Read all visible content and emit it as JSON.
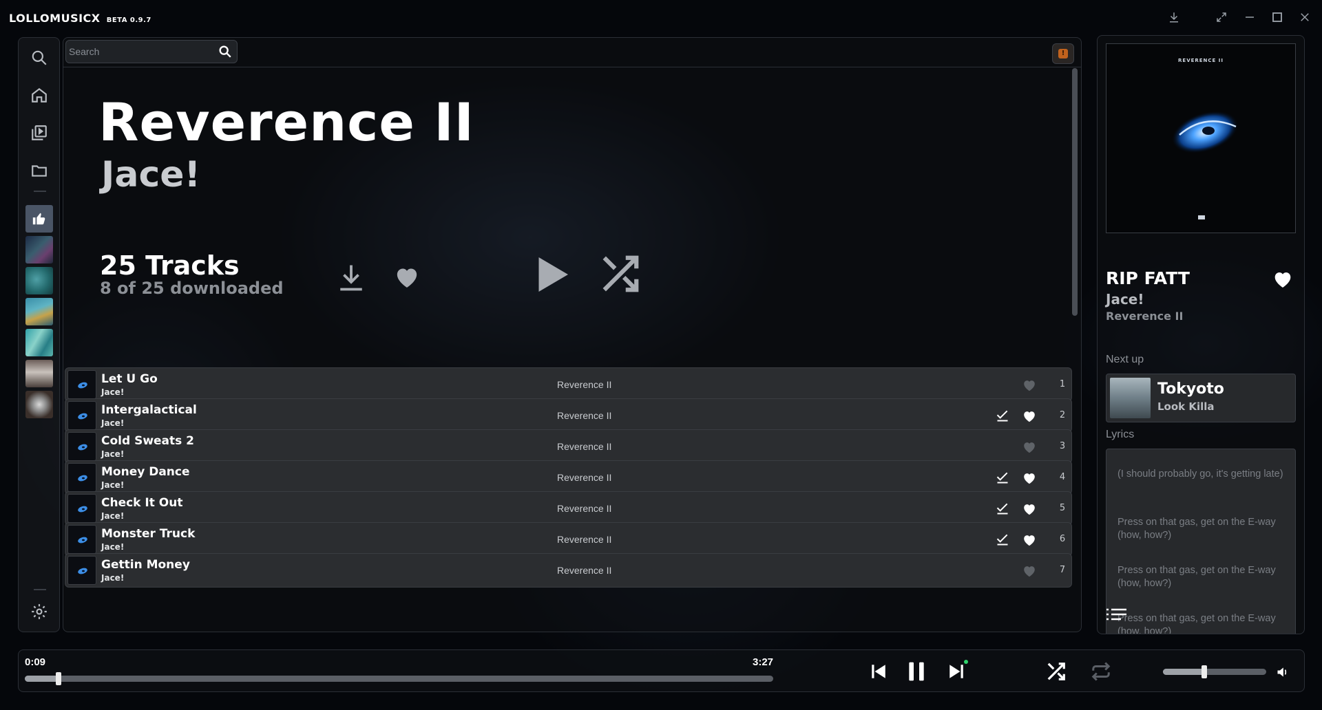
{
  "app": {
    "name": "LOLLOMUSICX",
    "version": "BETA 0.9.7"
  },
  "search": {
    "placeholder": "Search"
  },
  "alert_badge": "!",
  "album": {
    "title": "Reverence II",
    "artist": "Jace!",
    "track_count": "25 Tracks",
    "download_status": "8 of 25 downloaded"
  },
  "tracks": [
    {
      "title": "Let U Go",
      "artist": "Jace!",
      "album": "Reverence II",
      "number": "1",
      "downloaded": false,
      "liked": false
    },
    {
      "title": "Intergalactical",
      "artist": "Jace!",
      "album": "Reverence II",
      "number": "2",
      "downloaded": true,
      "liked": true
    },
    {
      "title": "Cold Sweats 2",
      "artist": "Jace!",
      "album": "Reverence II",
      "number": "3",
      "downloaded": false,
      "liked": false
    },
    {
      "title": "Money Dance",
      "artist": "Jace!",
      "album": "Reverence II",
      "number": "4",
      "downloaded": true,
      "liked": true
    },
    {
      "title": "Check It Out",
      "artist": "Jace!",
      "album": "Reverence II",
      "number": "5",
      "downloaded": true,
      "liked": true
    },
    {
      "title": "Monster Truck",
      "artist": "Jace!",
      "album": "Reverence II",
      "number": "6",
      "downloaded": true,
      "liked": true
    },
    {
      "title": "Gettin Money",
      "artist": "Jace!",
      "album": "Reverence II",
      "number": "7",
      "downloaded": false,
      "liked": false
    }
  ],
  "now_playing": {
    "cover_text": "REVERENCE II",
    "title": "RIP FATT",
    "artist": "Jace!",
    "album": "Reverence II",
    "liked": true
  },
  "next_up": {
    "label": "Next up",
    "title": "Tokyoto",
    "artist": "Look Killa"
  },
  "lyrics": {
    "label": "Lyrics",
    "lines": [
      "(I should probably go, it's getting late)",
      "Press on that gas, get on the E-way (how, how?)",
      "Press on that gas, get on the E-way (how, how?)",
      "Press on that gas, get on the E-way (how, how?)"
    ]
  },
  "player": {
    "elapsed": "0:09",
    "duration": "3:27",
    "progress": 0.045,
    "volume": 0.4,
    "shuffle_on": true,
    "repeat_on": false
  },
  "colors": {
    "background": "#05070b",
    "panel_border": "#2b2f36",
    "row_bg": "#2b2d30",
    "accent_alert": "#c0621d",
    "heart_inactive": "#5f6368",
    "heart_active": "#ffffff"
  },
  "icons": {
    "sidebar": [
      "search-icon",
      "home-icon",
      "library-icon",
      "folder-icon",
      "settings-icon"
    ],
    "window": [
      "download-icon",
      "fullscreen-icon",
      "minimize-icon",
      "maximize-icon",
      "close-icon"
    ]
  }
}
